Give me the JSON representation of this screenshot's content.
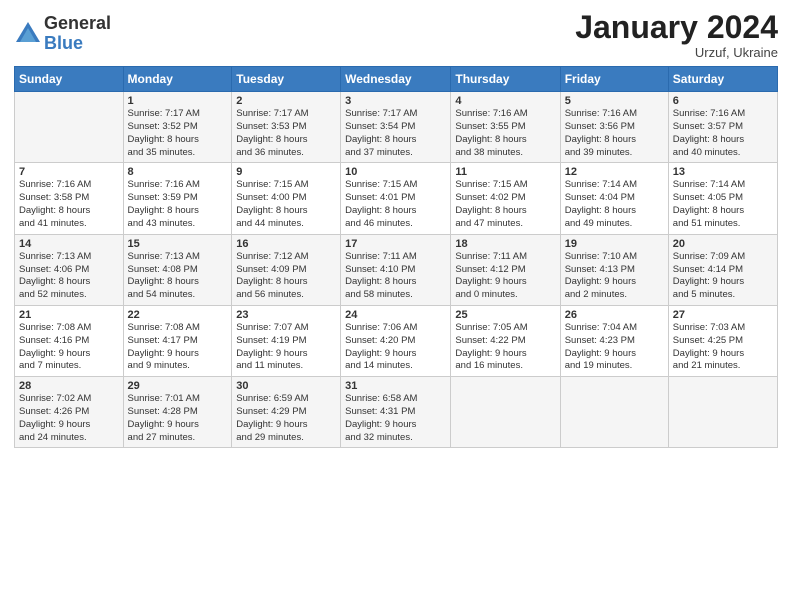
{
  "logo": {
    "general": "General",
    "blue": "Blue"
  },
  "title": "January 2024",
  "location": "Urzuf, Ukraine",
  "days_header": [
    "Sunday",
    "Monday",
    "Tuesday",
    "Wednesday",
    "Thursday",
    "Friday",
    "Saturday"
  ],
  "weeks": [
    [
      {
        "day": "",
        "info": ""
      },
      {
        "day": "1",
        "info": "Sunrise: 7:17 AM\nSunset: 3:52 PM\nDaylight: 8 hours\nand 35 minutes."
      },
      {
        "day": "2",
        "info": "Sunrise: 7:17 AM\nSunset: 3:53 PM\nDaylight: 8 hours\nand 36 minutes."
      },
      {
        "day": "3",
        "info": "Sunrise: 7:17 AM\nSunset: 3:54 PM\nDaylight: 8 hours\nand 37 minutes."
      },
      {
        "day": "4",
        "info": "Sunrise: 7:16 AM\nSunset: 3:55 PM\nDaylight: 8 hours\nand 38 minutes."
      },
      {
        "day": "5",
        "info": "Sunrise: 7:16 AM\nSunset: 3:56 PM\nDaylight: 8 hours\nand 39 minutes."
      },
      {
        "day": "6",
        "info": "Sunrise: 7:16 AM\nSunset: 3:57 PM\nDaylight: 8 hours\nand 40 minutes."
      }
    ],
    [
      {
        "day": "7",
        "info": "Sunrise: 7:16 AM\nSunset: 3:58 PM\nDaylight: 8 hours\nand 41 minutes."
      },
      {
        "day": "8",
        "info": "Sunrise: 7:16 AM\nSunset: 3:59 PM\nDaylight: 8 hours\nand 43 minutes."
      },
      {
        "day": "9",
        "info": "Sunrise: 7:15 AM\nSunset: 4:00 PM\nDaylight: 8 hours\nand 44 minutes."
      },
      {
        "day": "10",
        "info": "Sunrise: 7:15 AM\nSunset: 4:01 PM\nDaylight: 8 hours\nand 46 minutes."
      },
      {
        "day": "11",
        "info": "Sunrise: 7:15 AM\nSunset: 4:02 PM\nDaylight: 8 hours\nand 47 minutes."
      },
      {
        "day": "12",
        "info": "Sunrise: 7:14 AM\nSunset: 4:04 PM\nDaylight: 8 hours\nand 49 minutes."
      },
      {
        "day": "13",
        "info": "Sunrise: 7:14 AM\nSunset: 4:05 PM\nDaylight: 8 hours\nand 51 minutes."
      }
    ],
    [
      {
        "day": "14",
        "info": "Sunrise: 7:13 AM\nSunset: 4:06 PM\nDaylight: 8 hours\nand 52 minutes."
      },
      {
        "day": "15",
        "info": "Sunrise: 7:13 AM\nSunset: 4:08 PM\nDaylight: 8 hours\nand 54 minutes."
      },
      {
        "day": "16",
        "info": "Sunrise: 7:12 AM\nSunset: 4:09 PM\nDaylight: 8 hours\nand 56 minutes."
      },
      {
        "day": "17",
        "info": "Sunrise: 7:11 AM\nSunset: 4:10 PM\nDaylight: 8 hours\nand 58 minutes."
      },
      {
        "day": "18",
        "info": "Sunrise: 7:11 AM\nSunset: 4:12 PM\nDaylight: 9 hours\nand 0 minutes."
      },
      {
        "day": "19",
        "info": "Sunrise: 7:10 AM\nSunset: 4:13 PM\nDaylight: 9 hours\nand 2 minutes."
      },
      {
        "day": "20",
        "info": "Sunrise: 7:09 AM\nSunset: 4:14 PM\nDaylight: 9 hours\nand 5 minutes."
      }
    ],
    [
      {
        "day": "21",
        "info": "Sunrise: 7:08 AM\nSunset: 4:16 PM\nDaylight: 9 hours\nand 7 minutes."
      },
      {
        "day": "22",
        "info": "Sunrise: 7:08 AM\nSunset: 4:17 PM\nDaylight: 9 hours\nand 9 minutes."
      },
      {
        "day": "23",
        "info": "Sunrise: 7:07 AM\nSunset: 4:19 PM\nDaylight: 9 hours\nand 11 minutes."
      },
      {
        "day": "24",
        "info": "Sunrise: 7:06 AM\nSunset: 4:20 PM\nDaylight: 9 hours\nand 14 minutes."
      },
      {
        "day": "25",
        "info": "Sunrise: 7:05 AM\nSunset: 4:22 PM\nDaylight: 9 hours\nand 16 minutes."
      },
      {
        "day": "26",
        "info": "Sunrise: 7:04 AM\nSunset: 4:23 PM\nDaylight: 9 hours\nand 19 minutes."
      },
      {
        "day": "27",
        "info": "Sunrise: 7:03 AM\nSunset: 4:25 PM\nDaylight: 9 hours\nand 21 minutes."
      }
    ],
    [
      {
        "day": "28",
        "info": "Sunrise: 7:02 AM\nSunset: 4:26 PM\nDaylight: 9 hours\nand 24 minutes."
      },
      {
        "day": "29",
        "info": "Sunrise: 7:01 AM\nSunset: 4:28 PM\nDaylight: 9 hours\nand 27 minutes."
      },
      {
        "day": "30",
        "info": "Sunrise: 6:59 AM\nSunset: 4:29 PM\nDaylight: 9 hours\nand 29 minutes."
      },
      {
        "day": "31",
        "info": "Sunrise: 6:58 AM\nSunset: 4:31 PM\nDaylight: 9 hours\nand 32 minutes."
      },
      {
        "day": "",
        "info": ""
      },
      {
        "day": "",
        "info": ""
      },
      {
        "day": "",
        "info": ""
      }
    ]
  ]
}
